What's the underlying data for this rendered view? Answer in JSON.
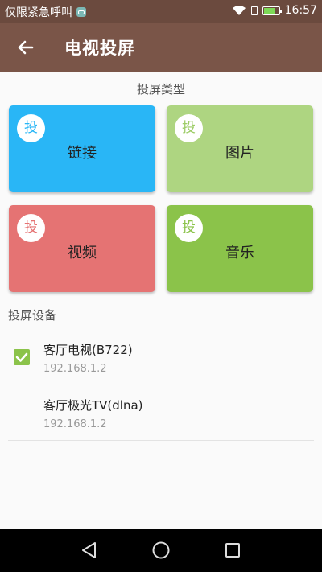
{
  "status_bar": {
    "carrier_text": "仅限紧急呼叫",
    "time": "16:57",
    "icons": [
      "app-notification-icon",
      "wifi-icon",
      "sim-icon",
      "battery-icon"
    ]
  },
  "app_bar": {
    "title": "电视投屏",
    "back_icon": "arrow-left-icon"
  },
  "cast_types": {
    "title": "投屏类型",
    "items": [
      {
        "badge": "投",
        "label": "链接",
        "bg": "#29b6f6",
        "badge_color": "#29b6f6"
      },
      {
        "badge": "投",
        "label": "图片",
        "bg": "#aed581",
        "badge_color": "#9ccc65"
      },
      {
        "badge": "投",
        "label": "视频",
        "bg": "#e57373",
        "badge_color": "#e57373"
      },
      {
        "badge": "投",
        "label": "音乐",
        "bg": "#8bc34a",
        "badge_color": "#8bc34a"
      }
    ]
  },
  "devices": {
    "title": "投屏设备",
    "items": [
      {
        "name": "客厅电视(B722)",
        "ip": "192.168.1.2",
        "checked": true
      },
      {
        "name": "客厅极光TV(dlna)",
        "ip": "192.168.1.2",
        "checked": false
      }
    ]
  },
  "nav_bar": {
    "icons": [
      "back-triangle-icon",
      "home-circle-icon",
      "recents-square-icon"
    ]
  },
  "colors": {
    "status_bar": "#6b4a3e",
    "app_bar": "#7a5548",
    "accent_check": "#8bc34a"
  }
}
